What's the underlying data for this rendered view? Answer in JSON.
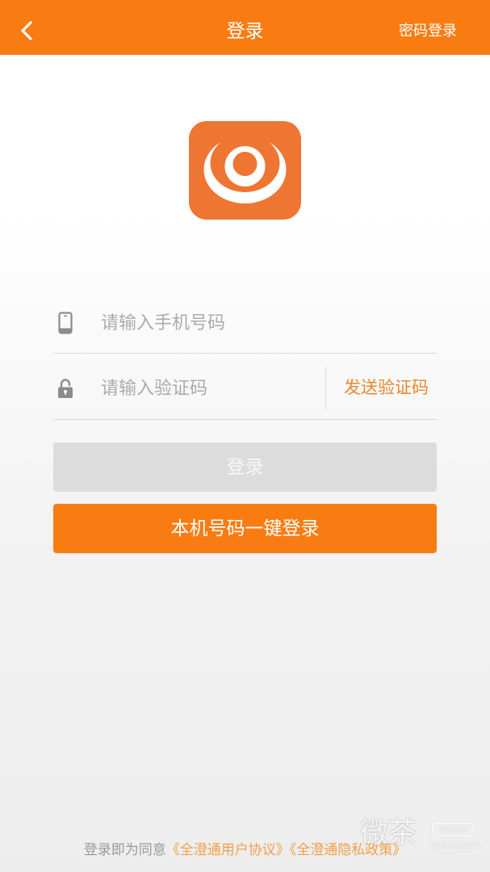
{
  "header": {
    "back_icon": "chevron-left-icon",
    "title": "登录",
    "password_login": "密码登录"
  },
  "logo": {
    "icon": "app-logo"
  },
  "form": {
    "phone": {
      "icon": "phone-icon",
      "placeholder": "请输入手机号码",
      "value": ""
    },
    "code": {
      "icon": "lock-icon",
      "placeholder": "请输入验证码",
      "value": ""
    },
    "send_code_label": "发送验证码"
  },
  "buttons": {
    "login_label": "登录",
    "one_click_label": "本机号码一键登录"
  },
  "footer": {
    "agree_text": "登录即为同意",
    "user_agreement": "《全澄通用户协议》",
    "privacy_policy": "《全澄通隐私政策》"
  },
  "watermark": {
    "brand_cn": "微茶",
    "brand_en": "WXCHA",
    "site": "wxcha.com"
  },
  "colors": {
    "accent": "#F97C13",
    "logo_background": "#EE7532",
    "disabled_button": "#DCDCDC",
    "placeholder": "#ABABAB",
    "link": "#F2A04A",
    "send_code": "#E8872E"
  }
}
